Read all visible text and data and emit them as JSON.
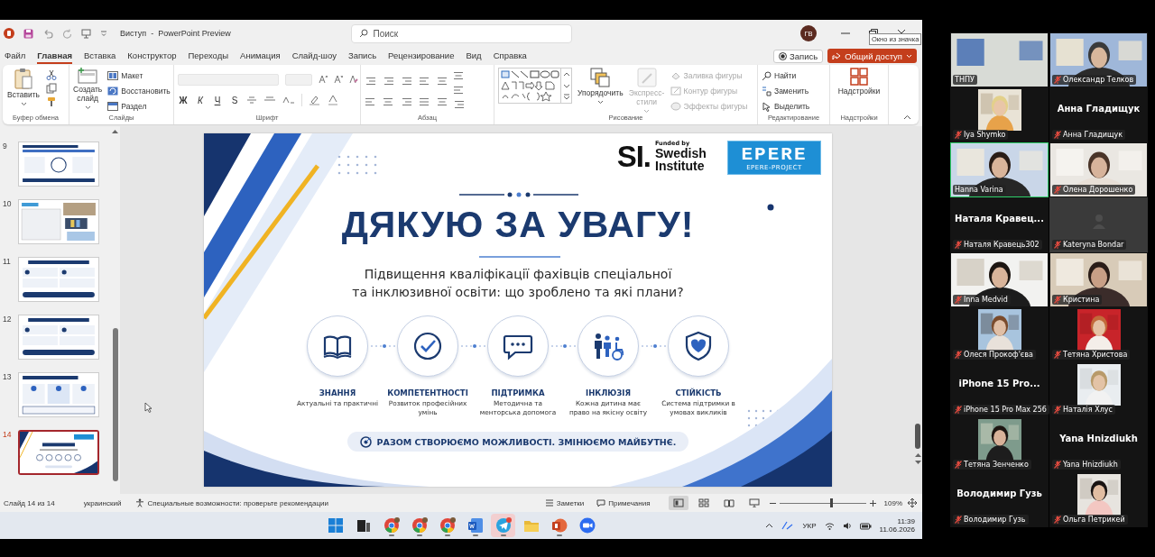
{
  "window": {
    "title": "Виступ  -  PowerPoint Preview",
    "search": {
      "placeholder": "Поиск"
    },
    "user_initials": "ГВ",
    "tooltip": "Окно из значка"
  },
  "menu_tabs": [
    {
      "label": "Файл",
      "selected": false
    },
    {
      "label": "Главная",
      "selected": true
    },
    {
      "label": "Вставка",
      "selected": false
    },
    {
      "label": "Конструктор",
      "selected": false
    },
    {
      "label": "Переходы",
      "selected": false
    },
    {
      "label": "Анимация",
      "selected": false
    },
    {
      "label": "Слайд-шоу",
      "selected": false
    },
    {
      "label": "Запись",
      "selected": false
    },
    {
      "label": "Рецензирование",
      "selected": false
    },
    {
      "label": "Вид",
      "selected": false
    },
    {
      "label": "Справка",
      "selected": false
    }
  ],
  "record_button": "Запись",
  "share_button": "Общий доступ",
  "ribbon": {
    "groups": [
      {
        "kind": "clipboard",
        "name": "Буфер обмена",
        "paste": "Вставить"
      },
      {
        "kind": "slides",
        "name": "Слайды",
        "new_slide": "Создать слайд",
        "commands": [
          {
            "label": "Макет",
            "disabled": false
          },
          {
            "label": "Восстановить",
            "disabled": false
          },
          {
            "label": "Раздел",
            "disabled": false
          }
        ]
      },
      {
        "kind": "font",
        "name": "Шрифт",
        "format_buttons": [
          "Ж",
          "К",
          "Ч",
          "S"
        ]
      },
      {
        "kind": "paragraph",
        "name": "Абзац"
      },
      {
        "kind": "drawing",
        "name": "Рисование",
        "arrange": "Упорядочить",
        "quick_styles": {
          "label": "Экспресс-стили",
          "disabled": true
        },
        "commands": [
          {
            "label": "Заливка фигуры",
            "disabled": true
          },
          {
            "label": "Контур фигуры",
            "disabled": true
          },
          {
            "label": "Эффекты фигуры",
            "disabled": true
          }
        ]
      },
      {
        "kind": "editing",
        "name": "Редактирование",
        "commands": [
          {
            "label": "Найти",
            "disabled": false
          },
          {
            "label": "Заменить",
            "disabled": false
          },
          {
            "label": "Выделить",
            "disabled": false
          }
        ]
      },
      {
        "kind": "addins",
        "name": "Надстройки",
        "button": "Надстройки"
      }
    ]
  },
  "slide_thumbnails": [
    {
      "number": "9",
      "kind": "diagram",
      "selected": false
    },
    {
      "number": "10",
      "kind": "collage",
      "selected": false
    },
    {
      "number": "11",
      "kind": "grid",
      "selected": false
    },
    {
      "number": "12",
      "kind": "grid",
      "selected": false
    },
    {
      "number": "13",
      "kind": "steps",
      "selected": false
    },
    {
      "number": "14",
      "kind": "title",
      "selected": true
    }
  ],
  "slide": {
    "logo": {
      "mark": "SI.",
      "funded_by": "Funded by",
      "name": "Swedish Institute"
    },
    "project_logo": {
      "name": "EPERE",
      "caption": "EPERE-PROJECT"
    },
    "title": "ДЯКУЮ ЗА УВАГУ!",
    "subtitle": [
      "Підвищення кваліфікації фахівців спеціальної",
      "та інклюзивної освіти: що зроблено та які плани?"
    ],
    "pillars": [
      {
        "kind": "book",
        "title": "ЗНАННЯ",
        "text": "Актуальні та практичні"
      },
      {
        "kind": "check",
        "title": "КОМПЕТЕНТНОСТІ",
        "text": "Розвиток професійних умінь"
      },
      {
        "kind": "chat",
        "title": "ПІДТРИМКА",
        "text": "Методична та менторська допомога"
      },
      {
        "kind": "people",
        "title": "ІНКЛЮЗІЯ",
        "text": "Кожна дитина має право на якісну освіту"
      },
      {
        "kind": "shield",
        "title": "СТІЙКІСТЬ",
        "text": "Система підтримки в умовах викликів"
      }
    ],
    "motto": "РАЗОМ СТВОРЮЄМО МОЖЛИВОСТІ. ЗМІНЮЄМО МАЙБУТНЄ."
  },
  "status_bar": {
    "slide_counter": "Слайд 14 из 14",
    "language": "украинский",
    "accessibility": "Специальные возможности: проверьте рекомендации",
    "notes": "Заметки",
    "comments": "Примечания",
    "views": [
      {
        "kind": "normal",
        "selected": true
      },
      {
        "kind": "sorter",
        "selected": false
      },
      {
        "kind": "reading",
        "selected": false
      },
      {
        "kind": "slideshow",
        "selected": false
      }
    ],
    "zoom": {
      "level": 0.6,
      "reading": "109%"
    }
  },
  "taskbar": {
    "apps": [
      {
        "kind": "start",
        "running": false,
        "highlighted": false
      },
      {
        "kind": "taskview",
        "running": false,
        "highlighted": false
      },
      {
        "kind": "browser",
        "running": true,
        "highlighted": false
      },
      {
        "kind": "browser",
        "running": true,
        "highlighted": false
      },
      {
        "kind": "browser",
        "running": true,
        "highlighted": false
      },
      {
        "kind": "document",
        "running": true,
        "highlighted": false
      },
      {
        "kind": "messenger",
        "running": true,
        "highlighted": true
      },
      {
        "kind": "folder",
        "running": false,
        "highlighted": false
      },
      {
        "kind": "presentation",
        "running": true,
        "highlighted": false
      },
      {
        "kind": "video",
        "running": false,
        "highlighted": false
      }
    ],
    "language": "УКР",
    "time": "11:39",
    "date": "11.06.2026"
  },
  "participants": [
    {
      "name": "ТНПУ",
      "kind": "video",
      "muted": false,
      "speaking": false
    },
    {
      "name": "Олександр Телков",
      "kind": "video",
      "muted": true,
      "speaking": false
    },
    {
      "name": "Iya Shymko",
      "muted": true,
      "speaking": false
    },
    {
      "name": "Анна Гладищук",
      "kind": "name",
      "display_name": "Анна Гладищук",
      "muted": true,
      "speaking": false
    },
    {
      "name": "Hanna Varina",
      "kind": "video",
      "muted": false,
      "speaking": true
    },
    {
      "name": "Олена Дорошенко",
      "kind": "video",
      "muted": true,
      "speaking": false
    },
    {
      "name": "Наталя Кравець302",
      "kind": "name",
      "display_name": "Наталя Кравец...",
      "muted": true,
      "speaking": false
    },
    {
      "name": "Kateryna Bondar",
      "kind": "blank",
      "muted": true,
      "speaking": false
    },
    {
      "name": "Inna Medvid",
      "kind": "video",
      "muted": true,
      "speaking": false
    },
    {
      "name": "Кристина",
      "kind": "video",
      "muted": true,
      "speaking": false
    },
    {
      "name": "Олеся Прокоф'єва",
      "muted": true,
      "speaking": false
    },
    {
      "name": "Тетяна Христова",
      "muted": true,
      "speaking": false
    },
    {
      "name": "iPhone 15 Pro Max 256",
      "kind": "name",
      "display_name": "iPhone 15 Pro...",
      "muted": true,
      "speaking": false
    },
    {
      "name": "Наталія Хлус",
      "muted": true,
      "speaking": false
    },
    {
      "name": "Тетяна Зенченко",
      "muted": true,
      "speaking": false
    },
    {
      "name": "Yana Hnizdiukh",
      "kind": "name",
      "display_name": "Yana Hnizdiukh",
      "muted": true,
      "speaking": false
    },
    {
      "name": "Володимир Гузь",
      "kind": "name",
      "display_name": "Володимир Гузь",
      "muted": true,
      "speaking": false
    },
    {
      "name": "Ольга Петрикей",
      "muted": true,
      "speaking": false
    }
  ]
}
